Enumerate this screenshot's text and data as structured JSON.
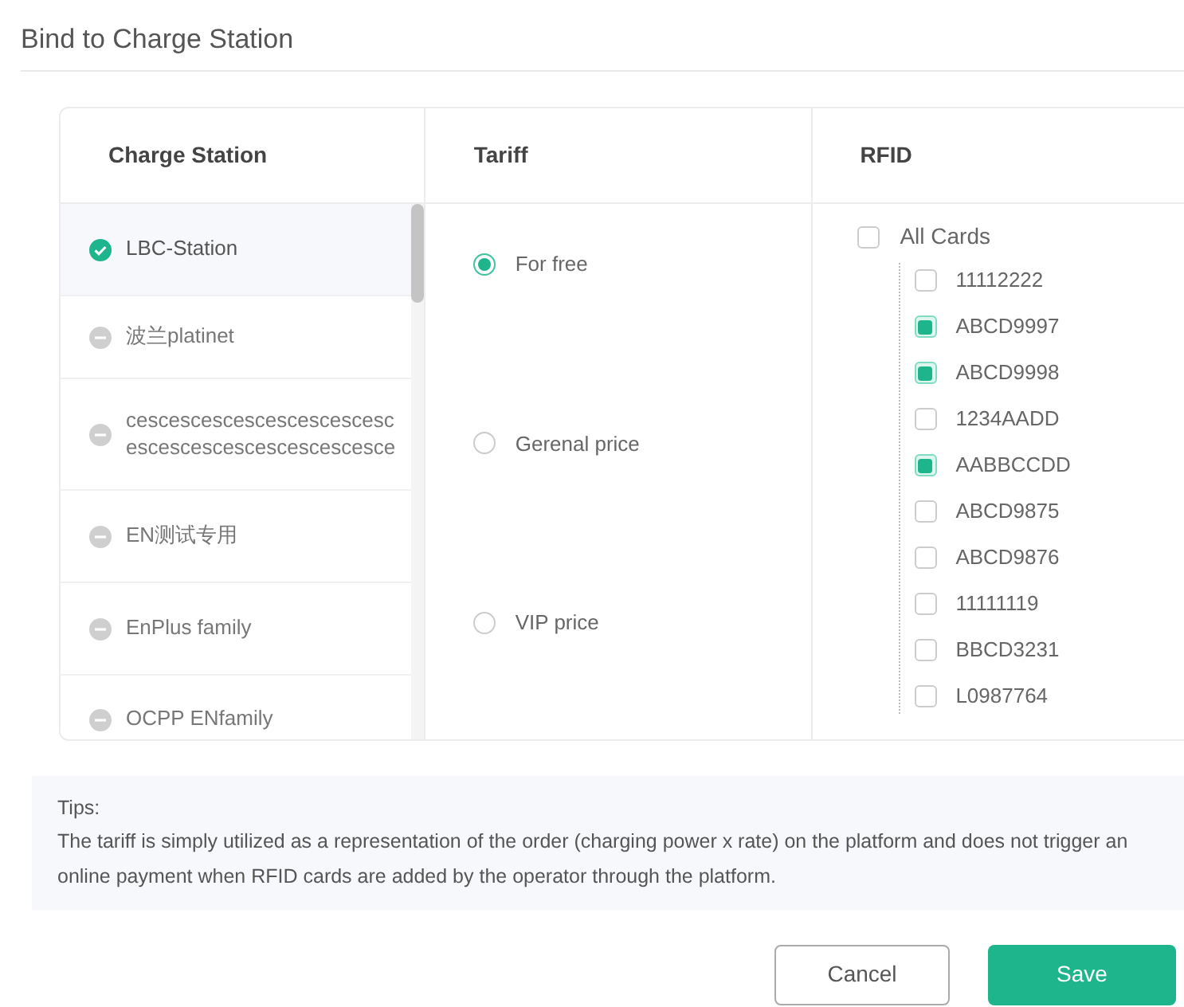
{
  "dialog": {
    "title": "Bind to Charge Station"
  },
  "columns": [
    "Charge Station",
    "Tariff",
    "RFID"
  ],
  "stations": [
    {
      "name": "LBC-Station",
      "bound": true,
      "selected": true
    },
    {
      "name": "波兰platinet",
      "bound": false,
      "selected": false
    },
    {
      "name": "cescescescescescescescescescescescescescescescesce",
      "bound": false,
      "selected": false
    },
    {
      "name": "EN测试专用",
      "bound": false,
      "selected": false
    },
    {
      "name": "EnPlus family",
      "bound": false,
      "selected": false
    },
    {
      "name": "OCPP ENfamily",
      "bound": false,
      "selected": false
    }
  ],
  "tariffs": [
    {
      "label": "For free",
      "selected": true
    },
    {
      "label": "Gerenal price",
      "selected": false
    },
    {
      "label": "VIP price",
      "selected": false
    }
  ],
  "rfid": {
    "all": {
      "label": "All Cards",
      "checked": false
    },
    "cards": [
      {
        "label": "11112222",
        "checked": false
      },
      {
        "label": "ABCD9997",
        "checked": true
      },
      {
        "label": "ABCD9998",
        "checked": true
      },
      {
        "label": "1234AADD",
        "checked": false
      },
      {
        "label": "AABBCCDD",
        "checked": true
      },
      {
        "label": "ABCD9875",
        "checked": false
      },
      {
        "label": "ABCD9876",
        "checked": false
      },
      {
        "label": "11111119",
        "checked": false
      },
      {
        "label": "BBCD3231",
        "checked": false
      },
      {
        "label": "L0987764",
        "checked": false
      }
    ]
  },
  "tips": {
    "heading": "Tips:",
    "text": "The tariff is simply utilized as a representation of the order (charging power x rate) on the platform and does not trigger an online payment when RFID cards are added by the operator through the platform."
  },
  "buttons": [
    {
      "label": "Cancel",
      "kind": "secondary"
    },
    {
      "label": "Save",
      "kind": "primary"
    }
  ]
}
